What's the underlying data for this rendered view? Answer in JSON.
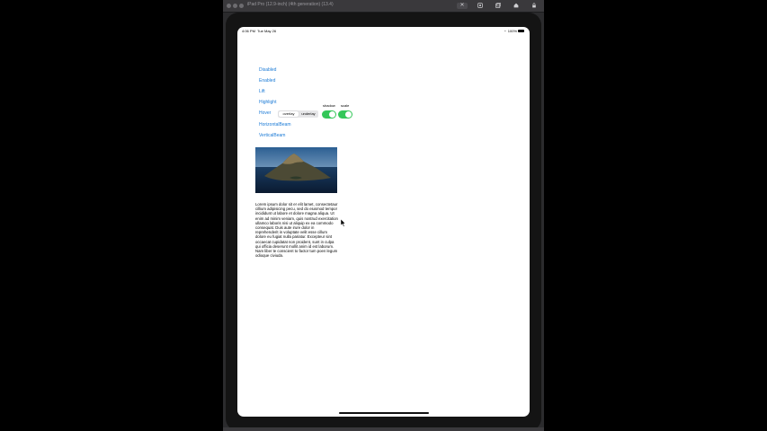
{
  "window": {
    "title": "iPad Pro (12.9-inch) (4th generation) (13.4)",
    "toolbar_icons": [
      "close-x-icon",
      "home-icon",
      "screenshot-icon",
      "rotate-icon",
      "lock-icon"
    ]
  },
  "status_bar": {
    "time": "4:06 PM",
    "date": "Tue May 26",
    "battery": "100%"
  },
  "menu": {
    "disabled": "Disabled",
    "enabled": "Enabled",
    "lift": "Lift",
    "highlight": "Highlight",
    "hover": "Hover",
    "horizontal_beam": "HorizontalBeam",
    "vertical_beam": "VerticalBeam"
  },
  "hover_controls": {
    "segment_options": [
      "overlay",
      "underlay"
    ],
    "selected_segment": "overlay",
    "shadow_label": "shadow",
    "scale_label": "scale",
    "shadow_on": true,
    "scale_on": true
  },
  "image": {
    "description_icon": "landscape-photo"
  },
  "body_text": "Lorem ipsum dolor sit er elit lamet, consectetaur cillium adipisicing pecu, sed do eiusmod tempor incididunt ut labore et dolore magna aliqua. Ut enim ad minim veniam, quis nostrud exercitation ullamco laboris nisi ut aliquip ex ea commodo consequat. Duis aute irure dolor in reprehenderit in voluptate velit esse cillum dolore eu fugiat nulla pariatur. Excepteur sint occaecat cupidatat non proident, sunt in culpa qui officia deserunt mollit anim id est laborum. Nam liber te conscient to factor tum poen legum odioque civiuda.",
  "colors": {
    "link": "#1a7ad6",
    "toggle_on": "#34c759"
  }
}
